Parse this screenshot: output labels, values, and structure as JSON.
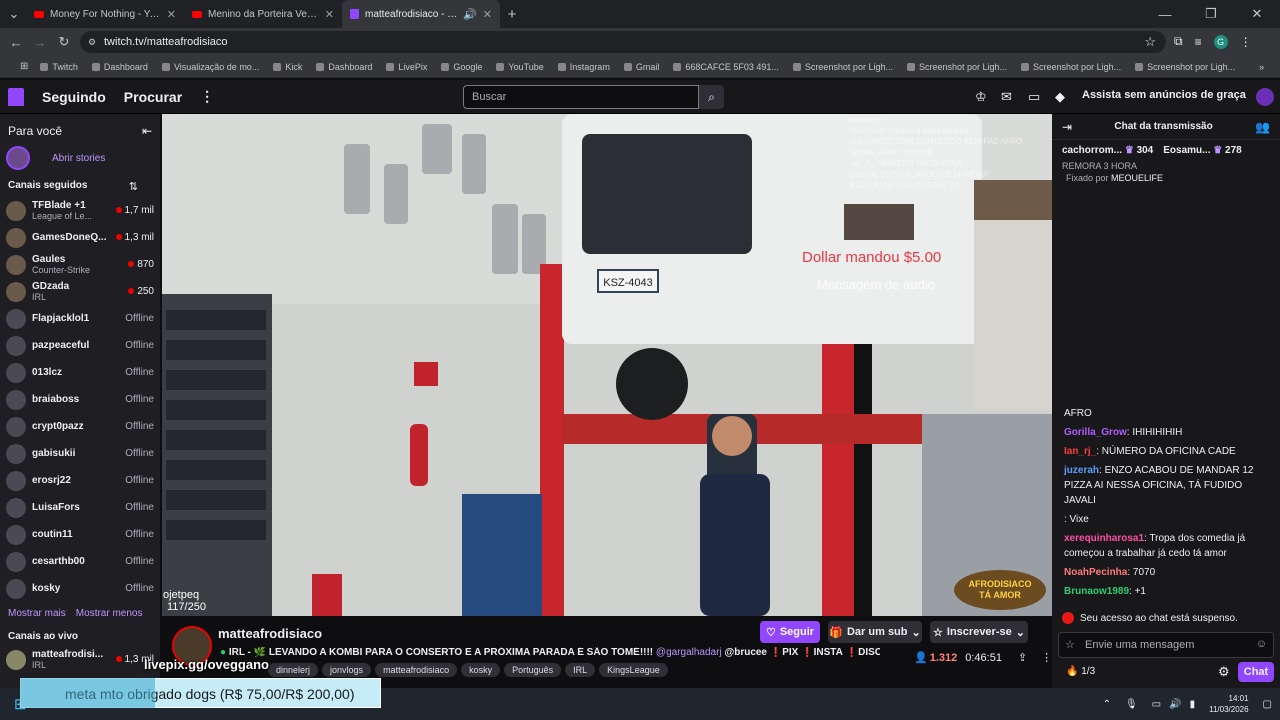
{
  "browser": {
    "tabs": [
      {
        "title": "Money For Nothing - YouTube",
        "fav": "yt"
      },
      {
        "title": "Menino da Porteira Versão Dire",
        "fav": "yt"
      },
      {
        "title": "matteafrodisiaco - Twitch",
        "fav": "tw",
        "active": true
      }
    ],
    "url": "twitch.tv/matteafrodisiaco",
    "bookmarks": [
      "Twitch",
      "Dashboard",
      "Visualização de mo...",
      "Kick",
      "Dashboard",
      "LivePix",
      "Google",
      "YouTube",
      "Instagram",
      "Gmail",
      "668CAFCE 5F03 491...",
      "Screenshot por Ligh...",
      "Screenshot por Ligh...",
      "Screenshot por Ligh...",
      "Screenshot por Ligh..."
    ],
    "profile_initial": "G"
  },
  "nav": {
    "following": "Seguindo",
    "browse": "Procurar",
    "search_placeholder": "Buscar",
    "prime": "Assista sem anúncios de graça"
  },
  "sidebar": {
    "for_you": "Para você",
    "stories": "Abrir stories",
    "followed_header": "Canais seguidos",
    "channels": [
      {
        "name": "TFBlade +1",
        "sub": "League of Le...",
        "viewers": "1,7 mil",
        "live": true
      },
      {
        "name": "GamesDoneQ...",
        "sub": "",
        "viewers": "1,3 mil",
        "live": true
      },
      {
        "name": "Gaules",
        "sub": "Counter-Strike",
        "viewers": "870",
        "live": true
      },
      {
        "name": "GDzada",
        "sub": "IRL",
        "viewers": "250",
        "live": true
      },
      {
        "name": "Flapjacklol1",
        "sub": "",
        "viewers": "Offline",
        "live": false
      },
      {
        "name": "pazpeaceful",
        "sub": "",
        "viewers": "Offline",
        "live": false
      },
      {
        "name": "013lcz",
        "sub": "",
        "viewers": "Offline",
        "live": false
      },
      {
        "name": "braiaboss",
        "sub": "",
        "viewers": "Offline",
        "live": false
      },
      {
        "name": "crypt0pazz",
        "sub": "",
        "viewers": "Offline",
        "live": false
      },
      {
        "name": "gabisukii",
        "sub": "",
        "viewers": "Offline",
        "live": false
      },
      {
        "name": "erosrj22",
        "sub": "",
        "viewers": "Offline",
        "live": false
      },
      {
        "name": "LuisaFors",
        "sub": "",
        "viewers": "Offline",
        "live": false
      },
      {
        "name": "coutin11",
        "sub": "",
        "viewers": "Offline",
        "live": false
      },
      {
        "name": "cesarthb00",
        "sub": "",
        "viewers": "Offline",
        "live": false
      },
      {
        "name": "kosky",
        "sub": "",
        "viewers": "Offline",
        "live": false
      }
    ],
    "show_more": "Mostrar mais",
    "show_less": "Mostrar menos",
    "live_header": "Canais ao vivo",
    "live_channel": {
      "name": "matteafrodisi...",
      "sub": "IRL",
      "viewers": "1,3 mil"
    }
  },
  "video": {
    "overlay_lines": [
      "endereço",
      "choncera: chegou a papa do loko",
      "marcelo557: SEM CONTEÚDO SEM PAZ AFRO",
      "Gorilla_Grow: IHIHIHIH",
      "Ian_ri_: NÚMERO DA OFICINA",
      "juzerah: ENZO ACABOU DE MANDAR",
      "PIZZA AI NESSA OFICINA, TÁ"
    ],
    "donation": "Dollar mandou $5.00",
    "audio": "Mensagem de áudio",
    "plate": "KSZ-4043",
    "tip_name": "ojetpeq",
    "tip_amount": "117/250",
    "logo_text": "AFRODISIACO TA AMOR"
  },
  "stream": {
    "channel": "matteafrodisiaco",
    "title": "IRL - 🌿 LEVANDO A KOMBI PARA O CONSERTO E A PRÓXIMA PARADA É SÃO TOMÉ!!!!",
    "mentions": "@gargalhadarj",
    "mention2": "@brucee",
    "links": [
      "PIX",
      "INSTA",
      "DISCORD"
    ],
    "tags": [
      "dinnelerj",
      "jonvlogs",
      "matteafrodisiaco",
      "kosky",
      "Português",
      "IRL",
      "KingsLeague"
    ],
    "follow": "Seguir",
    "gift_sub": "Dar um sub",
    "subscribe": "Inscrever-se",
    "viewers": "1.312",
    "uptime": "0:46:51"
  },
  "chat": {
    "title": "Chat da transmissão",
    "gifters": [
      {
        "name": "cachorrom...",
        "count": "304"
      },
      {
        "name": "Eosamu...",
        "count": "278"
      }
    ],
    "pinned_hint": "REMORA 3 HORA",
    "pinned_by": "Fixado por",
    "pinned_user": "MEOUELIFE",
    "messages": [
      {
        "user": "",
        "color": "#efeff1",
        "text": "AFRO"
      },
      {
        "user": "Gorilla_Grow",
        "color": "#b05cff",
        "text": ": IHIHIHIHIH"
      },
      {
        "user": "Ian_rj_",
        "color": "#ff3b3b",
        "text": ": NÚMERO DA OFICINA CADE"
      },
      {
        "user": "juzerah",
        "color": "#5c9dff",
        "text": ": ENZO ACABOU DE MANDAR 12 PIZZA AI NESSA OFICINA, TÁ FUDIDO JAVALI"
      },
      {
        "user": "",
        "color": "#ff4d4d",
        "text": ": Vixe"
      },
      {
        "user": "xerequinharosa1",
        "color": "#ff4fa3",
        "text": ": Tropa dos comedia já começou a trabalhar já cedo tá amor"
      },
      {
        "user": "NoahPecinha",
        "color": "#ff7a7a",
        "text": ": 7070"
      },
      {
        "user": "Brunaow1989",
        "color": "#2ecc71",
        "text": ": +1"
      }
    ],
    "suspended": "Seu acesso ao chat está suspenso.",
    "input_placeholder": "Envie uma mensagem",
    "points": "1/3",
    "chat_button": "Chat"
  },
  "overlay": {
    "livepix": "livepix.gg/oveggano",
    "toast": "meta mto obrigado dogs (R$ 75,00/R$ 200,00)",
    "goal_progress": 0.375
  },
  "taskbar": {
    "time": "14:01",
    "date": "11/03/2026"
  }
}
